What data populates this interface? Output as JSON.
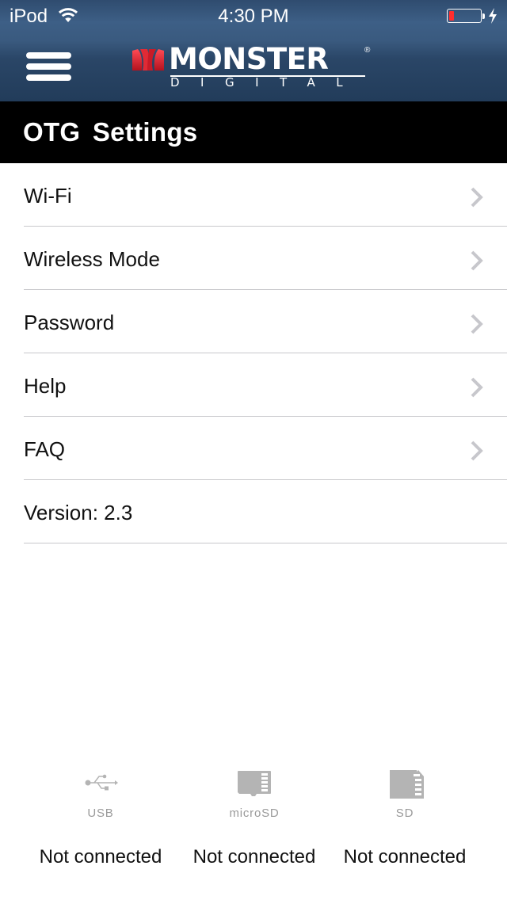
{
  "status_bar": {
    "carrier": "iPod",
    "time": "4:30 PM",
    "battery_level_percent": 15,
    "charging": true,
    "icons": [
      "wifi-icon",
      "battery-icon",
      "charging-bolt-icon"
    ]
  },
  "header": {
    "menu_icon": "hamburger-menu-icon",
    "logo": {
      "wordmark": "MONSTER",
      "registered": "®",
      "subtitle": "DIGITAL"
    },
    "colors": {
      "header_blue": "#2f4c6f",
      "logo_red": "#d61f2c"
    }
  },
  "titlebar": {
    "title": "OTG  Settings"
  },
  "settings": {
    "items": [
      {
        "label": "Wi-Fi",
        "has_chevron": true
      },
      {
        "label": "Wireless Mode",
        "has_chevron": true
      },
      {
        "label": "Password",
        "has_chevron": true
      },
      {
        "label": "Help",
        "has_chevron": true
      },
      {
        "label": "FAQ",
        "has_chevron": true
      }
    ],
    "version_label": "Version: 2.3"
  },
  "devices": [
    {
      "icon": "usb-icon",
      "label": "USB",
      "status": "Not connected"
    },
    {
      "icon": "microsd-card-icon",
      "label": "microSD",
      "status": "Not connected"
    },
    {
      "icon": "sd-card-icon",
      "label": "SD",
      "status": "Not connected"
    }
  ]
}
